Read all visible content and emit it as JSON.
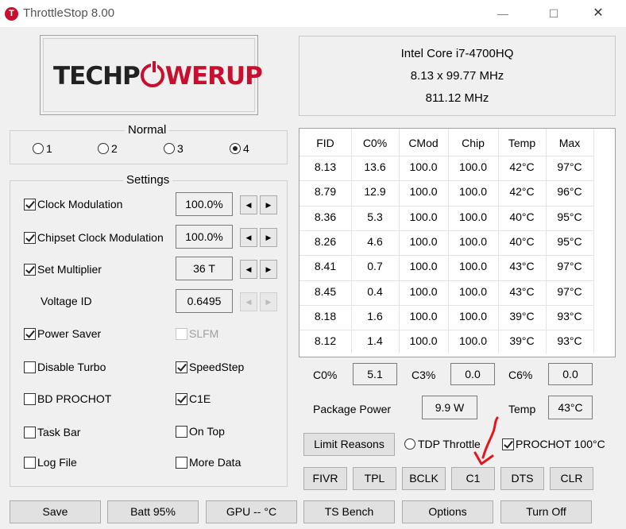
{
  "window": {
    "title": "ThrottleStop 8.00",
    "icon_letter": "T",
    "minimize": "—",
    "maximize": "☐",
    "close": "✕"
  },
  "logo": {
    "part1": "TECHP",
    "part2": "WERUP"
  },
  "cpu": {
    "name": "Intel Core i7-4700HQ",
    "multiplier": "8.13 x 99.77 MHz",
    "freq": "811.12 MHz"
  },
  "profile": {
    "title": "Normal",
    "options": [
      "1",
      "2",
      "3",
      "4"
    ],
    "selected": "4"
  },
  "settings": {
    "title": "Settings",
    "clock_modulation": {
      "label": "Clock Modulation",
      "value": "100.0%"
    },
    "chipset_clock": {
      "label": "Chipset Clock Modulation",
      "value": "100.0%"
    },
    "set_multiplier": {
      "label": "Set Multiplier",
      "value": "36 T"
    },
    "voltage_id": {
      "label": "Voltage ID",
      "value": "0.6495"
    },
    "power_saver": "Power Saver",
    "slfm": "SLFM",
    "disable_turbo": "Disable Turbo",
    "speedstep": "SpeedStep",
    "bd_prochot": "BD PROCHOT",
    "c1e": "C1E",
    "task_bar": "Task Bar",
    "on_top": "On Top",
    "log_file": "Log File",
    "more_data": "More Data"
  },
  "arrows": {
    "left": "◀",
    "right": "▶"
  },
  "table": {
    "headers": [
      "FID",
      "C0%",
      "CMod",
      "Chip",
      "Temp",
      "Max"
    ],
    "rows": [
      [
        "8.13",
        "13.6",
        "100.0",
        "100.0",
        "42°C",
        "97°C"
      ],
      [
        "8.79",
        "12.9",
        "100.0",
        "100.0",
        "42°C",
        "96°C"
      ],
      [
        "8.36",
        "5.3",
        "100.0",
        "100.0",
        "40°C",
        "95°C"
      ],
      [
        "8.26",
        "4.6",
        "100.0",
        "100.0",
        "40°C",
        "95°C"
      ],
      [
        "8.41",
        "0.7",
        "100.0",
        "100.0",
        "43°C",
        "97°C"
      ],
      [
        "8.45",
        "0.4",
        "100.0",
        "100.0",
        "43°C",
        "97°C"
      ],
      [
        "8.18",
        "1.6",
        "100.0",
        "100.0",
        "39°C",
        "93°C"
      ],
      [
        "8.12",
        "1.4",
        "100.0",
        "100.0",
        "39°C",
        "93°C"
      ]
    ]
  },
  "cstates": {
    "c0_label": "C0%",
    "c0_value": "5.1",
    "c3_label": "C3%",
    "c3_value": "0.0",
    "c6_label": "C6%",
    "c6_value": "0.0"
  },
  "power": {
    "label": "Package Power",
    "value": "9.9 W",
    "temp_label": "Temp",
    "temp_value": "43°C"
  },
  "limit_reasons": "Limit Reasons",
  "tdp_throttle": "TDP Throttle",
  "prochot": "PROCHOT 100°C",
  "tool_buttons": [
    "FIVR",
    "TPL",
    "BCLK",
    "C1",
    "DTS",
    "CLR"
  ],
  "bottom_buttons": [
    "Save",
    "Batt 95%",
    "GPU -- °C",
    "TS Bench",
    "Options",
    "Turn Off"
  ],
  "colors": {
    "brand_red": "#c8102e",
    "annotation_red": "#e8141c"
  }
}
